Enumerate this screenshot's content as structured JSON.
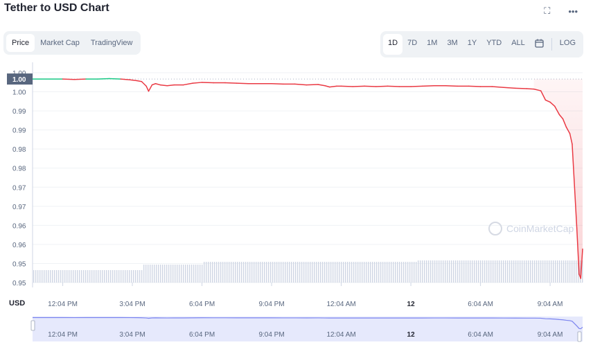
{
  "header": {
    "title": "Tether to USD Chart",
    "fullscreen_icon": "expand-icon",
    "more_icon": "more-dots-icon"
  },
  "tabs": [
    {
      "label": "Price",
      "active": true
    },
    {
      "label": "Market Cap",
      "active": false
    },
    {
      "label": "TradingView",
      "active": false
    }
  ],
  "ranges": [
    {
      "label": "1D",
      "active": true
    },
    {
      "label": "7D",
      "active": false
    },
    {
      "label": "1M",
      "active": false
    },
    {
      "label": "3M",
      "active": false
    },
    {
      "label": "1Y",
      "active": false
    },
    {
      "label": "YTD",
      "active": false
    },
    {
      "label": "ALL",
      "active": false
    }
  ],
  "calendar_icon": "calendar-icon",
  "log_label": "LOG",
  "watermark": "CoinMarketCap",
  "colors": {
    "up": "#16c784",
    "down": "#ea3943",
    "volume": "#cfd6e4",
    "navigator": "#7b84ef"
  },
  "chart_data": {
    "type": "line",
    "title": "Tether to USD Chart",
    "ylabel": "USD",
    "y_ticks": [
      "1.00",
      "1.00",
      "0.99",
      "0.99",
      "0.98",
      "0.98",
      "0.97",
      "0.97",
      "0.96",
      "0.96",
      "0.95",
      "0.95"
    ],
    "current_price_label": "1.00",
    "ylim": [
      0.952,
      1.002
    ],
    "x_ticks": [
      "12:04 PM",
      "3:04 PM",
      "6:04 PM",
      "9:04 PM",
      "12:04 AM",
      "12",
      "6:04 AM",
      "9:04 AM"
    ],
    "x_tick_bold_index": 5,
    "x_hours": [
      0,
      3,
      6,
      9,
      12,
      15,
      18,
      21
    ],
    "x_range_hours": [
      -1.3,
      22.4
    ],
    "reference_price": 1.0005,
    "series": [
      {
        "values": [
          [
            -1.3,
            1.0005
          ],
          [
            0.0,
            1.0005
          ],
          [
            0.5,
            1.0004
          ],
          [
            1.0,
            1.0005
          ],
          [
            1.5,
            1.0005
          ],
          [
            2.0,
            1.0006
          ],
          [
            2.5,
            1.0005
          ],
          [
            2.9,
            1.0003
          ],
          [
            3.2,
            1.0001
          ],
          [
            3.4,
            0.9999
          ],
          [
            3.6,
            0.9988
          ],
          [
            3.7,
            0.9976
          ],
          [
            3.85,
            0.9991
          ],
          [
            4.0,
            0.9994
          ],
          [
            4.2,
            0.9991
          ],
          [
            4.5,
            0.9989
          ],
          [
            4.8,
            0.9991
          ],
          [
            5.2,
            0.9991
          ],
          [
            5.6,
            0.9995
          ],
          [
            6.0,
            0.9997
          ],
          [
            6.5,
            0.9996
          ],
          [
            7.0,
            0.9996
          ],
          [
            7.5,
            0.9995
          ],
          [
            8.0,
            0.9994
          ],
          [
            8.5,
            0.9994
          ],
          [
            9.0,
            0.9994
          ],
          [
            9.5,
            0.9993
          ],
          [
            10.0,
            0.9993
          ],
          [
            10.5,
            0.9991
          ],
          [
            11.0,
            0.9992
          ],
          [
            11.3,
            0.9989
          ],
          [
            11.5,
            0.9986
          ],
          [
            11.8,
            0.9988
          ],
          [
            12.0,
            0.9988
          ],
          [
            12.5,
            0.9987
          ],
          [
            13.0,
            0.9988
          ],
          [
            13.5,
            0.9987
          ],
          [
            14.0,
            0.9988
          ],
          [
            14.5,
            0.9987
          ],
          [
            15.0,
            0.9987
          ],
          [
            15.5,
            0.9988
          ],
          [
            16.0,
            0.9989
          ],
          [
            16.5,
            0.9989
          ],
          [
            17.0,
            0.9988
          ],
          [
            17.5,
            0.9988
          ],
          [
            18.0,
            0.9987
          ],
          [
            18.5,
            0.9987
          ],
          [
            19.0,
            0.9985
          ],
          [
            19.5,
            0.9983
          ],
          [
            20.0,
            0.9982
          ],
          [
            20.3,
            0.9981
          ],
          [
            20.6,
            0.9977
          ],
          [
            20.8,
            0.9955
          ],
          [
            21.0,
            0.995
          ],
          [
            21.2,
            0.994
          ],
          [
            21.4,
            0.992
          ],
          [
            21.55,
            0.991
          ],
          [
            21.7,
            0.989
          ],
          [
            21.85,
            0.9875
          ],
          [
            21.95,
            0.985
          ],
          [
            22.05,
            0.975
          ],
          [
            22.15,
            0.965
          ],
          [
            22.25,
            0.954
          ],
          [
            22.32,
            0.953
          ],
          [
            22.4,
            0.96
          ]
        ]
      }
    ]
  }
}
